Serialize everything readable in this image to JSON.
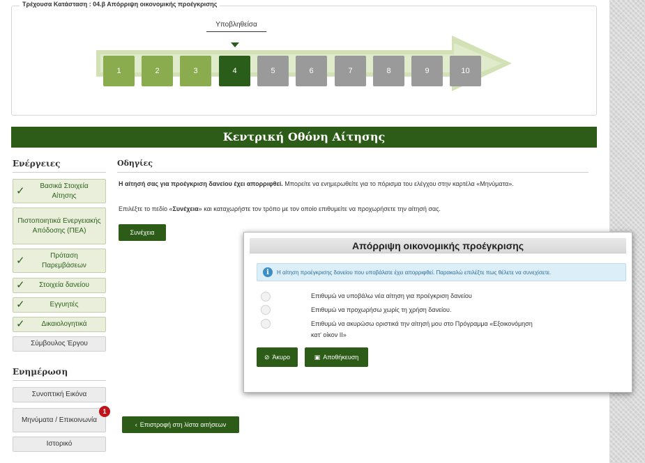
{
  "status": {
    "legend": "Τρέχουσα Κατάσταση : 04.β Απόρριψη οικονομικής προέγκρισης",
    "sub_label": "Υποβληθείσα",
    "steps": [
      "1",
      "2",
      "3",
      "4",
      "5",
      "6",
      "7",
      "8",
      "9",
      "10"
    ],
    "current_step": 4
  },
  "banner": {
    "title": "Κεντρική Οθόνη Αίτησης"
  },
  "sidebar": {
    "actions_title": "Ενέργειες",
    "actions": [
      {
        "label": "Βασικά Στοιχεία Αίτησης",
        "checked": true
      },
      {
        "label": "Πιστοποιητικά Ενεργειακής Απόδοσης (ΠΕΑ)",
        "checked": false
      },
      {
        "label": "Πρόταση Παρεμβάσεων",
        "checked": true
      },
      {
        "label": "Στοιχεία δανείου",
        "checked": true
      },
      {
        "label": "Εγγυητές",
        "checked": true
      },
      {
        "label": "Δικαιολογητικά",
        "checked": true
      },
      {
        "label": "Σύμβουλος Έργου",
        "checked": false
      }
    ],
    "info_title": "Ενημέρωση",
    "info_items": [
      {
        "label": "Συνοπτική Εικόνα"
      },
      {
        "label": "Μηνύματα / Επικοινωνία",
        "badge": "1"
      },
      {
        "label": "Ιστορικό"
      }
    ]
  },
  "main": {
    "title": "Οδηγίες",
    "line1_bold": "Η αίτησή σας για προέγκριση δανείου έχει απορριφθεί.",
    "line1_rest": " Μπορείτε να ενημερωθείτε για το πόρισμα του ελέγχου στην καρτέλα «Μηνύματα».",
    "line2_pre": "Επιλέξτε το πεδίο «",
    "line2_bold": "Συνέχεια",
    "line2_post": "» και καταχωρήστε τον τρόπο με τον οποίο επιθυμείτε να προχωρήσετε την αίτησή σας.",
    "continue_label": "Συνέχεια",
    "back_label": "Επιστροφή στη λίστα αιτήσεων"
  },
  "modal": {
    "title": "Απόρριψη οικονομικής προέγκρισης",
    "info": "Η αίτηση προέγκρισης δανείου που υποβάλατε έχει απορριφθεί. Παρακαλώ επιλέξτε πως θέλετε να συνεχίσετε.",
    "options": [
      "Επιθυμώ να υποβάλω νέα αίτηση για προέγκριση δανείου",
      "Επιθυμώ να προχωρήσω χωρίς τη χρήση δανείου.",
      "Επιθυμώ να ακυρώσω οριστικά την αίτησή μου στο Πρόγραμμα «Εξοικονόμηση",
      "κατ' οίκον ΙΙ»"
    ],
    "cancel_label": "Άκυρο",
    "save_label": "Αποθήκευση"
  },
  "colors": {
    "brand_green": "#2d5b18",
    "step_done": "#8aac4f",
    "step_todo": "#9a9a9a",
    "badge_red": "#c0141a"
  }
}
